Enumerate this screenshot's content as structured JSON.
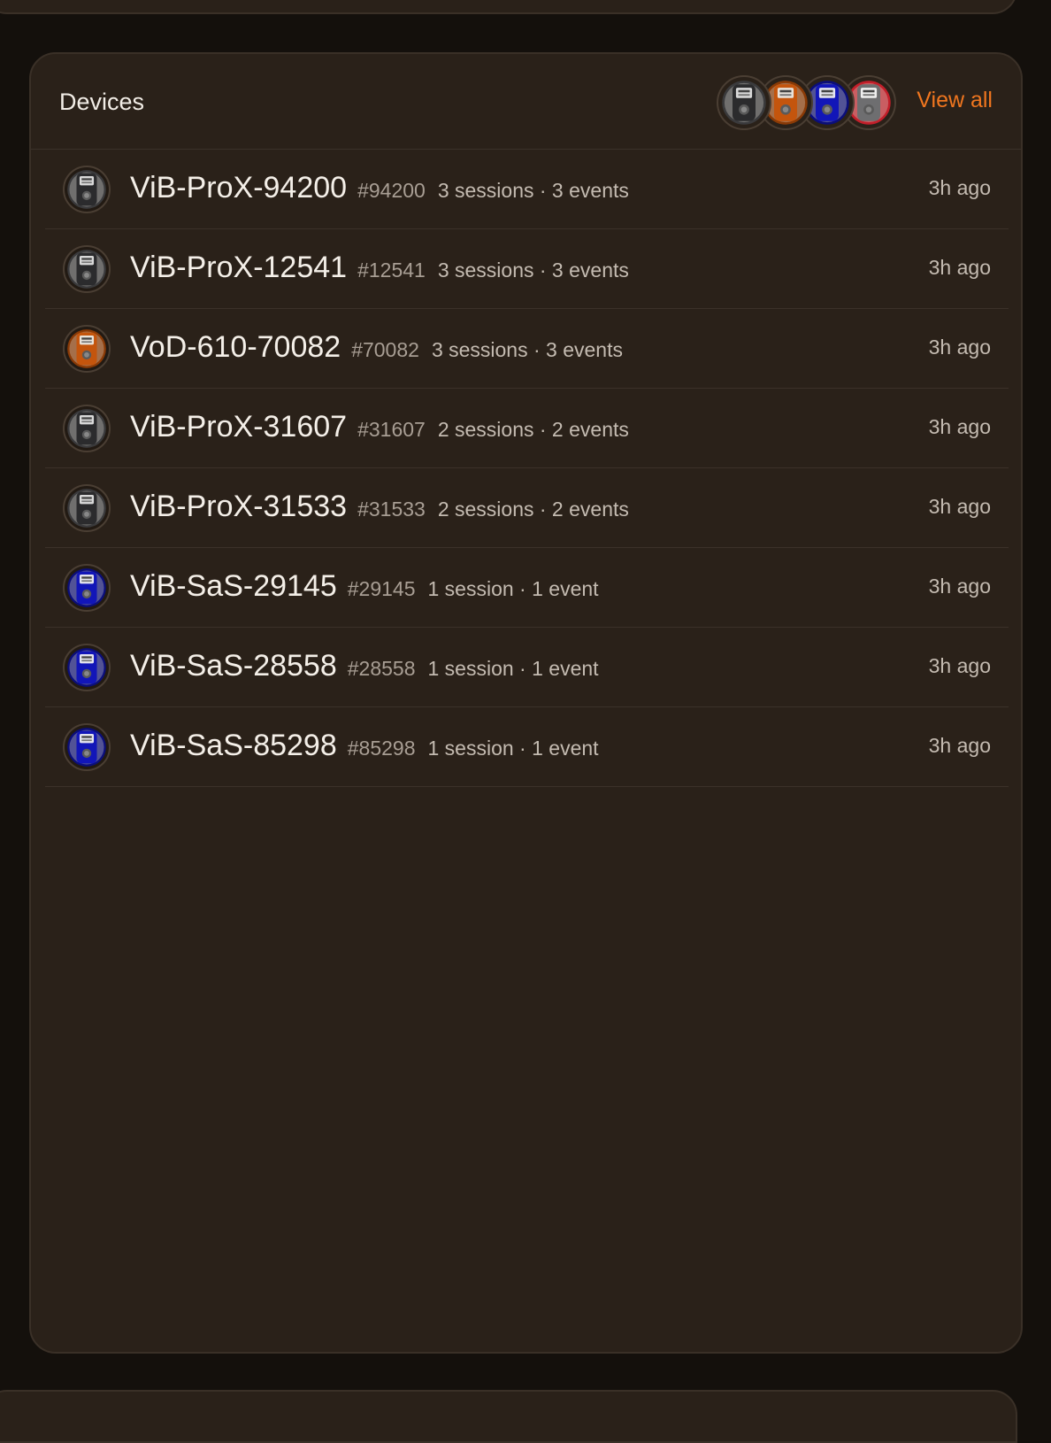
{
  "panel": {
    "title": "Devices",
    "view_all_label": "View all",
    "accent_color": "#f0761f",
    "stack_avatars": [
      {
        "variant": "black",
        "icon": "device-black-icon"
      },
      {
        "variant": "orange",
        "icon": "device-orange-icon"
      },
      {
        "variant": "blue",
        "icon": "device-blue-icon"
      },
      {
        "variant": "grey",
        "icon": "device-grey-icon"
      }
    ]
  },
  "devices": [
    {
      "name": "ViB-ProX-94200",
      "id": "#94200",
      "stats": "3 sessions · 3 events",
      "time": "3h ago",
      "variant": "black"
    },
    {
      "name": "ViB-ProX-12541",
      "id": "#12541",
      "stats": "3 sessions · 3 events",
      "time": "3h ago",
      "variant": "black"
    },
    {
      "name": "VoD-610-70082",
      "id": "#70082",
      "stats": "3 sessions · 3 events",
      "time": "3h ago",
      "variant": "orange"
    },
    {
      "name": "ViB-ProX-31607",
      "id": "#31607",
      "stats": "2 sessions · 2 events",
      "time": "3h ago",
      "variant": "black"
    },
    {
      "name": "ViB-ProX-31533",
      "id": "#31533",
      "stats": "2 sessions · 2 events",
      "time": "3h ago",
      "variant": "black"
    },
    {
      "name": "ViB-SaS-29145",
      "id": "#29145",
      "stats": "1 session · 1 event",
      "time": "3h ago",
      "variant": "blue"
    },
    {
      "name": "ViB-SaS-28558",
      "id": "#28558",
      "stats": "1 session · 1 event",
      "time": "3h ago",
      "variant": "blue"
    },
    {
      "name": "ViB-SaS-85298",
      "id": "#85298",
      "stats": "1 session · 1 event",
      "time": "3h ago",
      "variant": "blue"
    }
  ],
  "variant_colors": {
    "black": {
      "body": "#2b2b2d",
      "face": "#d9d9d9",
      "ring": "#3a3a3c"
    },
    "orange": {
      "body": "#c4550d",
      "face": "#e8e2da",
      "ring": "#8a3a06"
    },
    "blue": {
      "body": "#1216b8",
      "face": "#e4e4ee",
      "ring": "#0b0e7a"
    },
    "grey": {
      "body": "#6e6e70",
      "face": "#eeeeee",
      "ring": "#c21f2a"
    }
  }
}
